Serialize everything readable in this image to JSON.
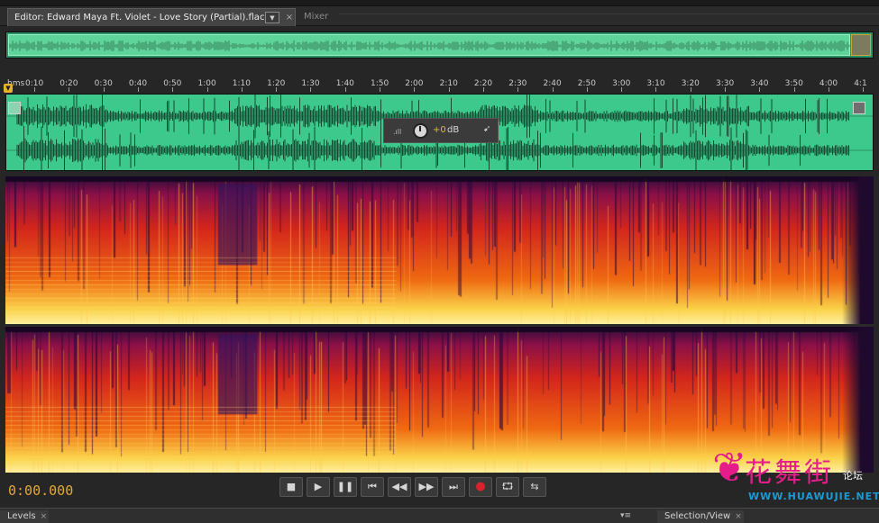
{
  "editor_tab": {
    "label": "Editor: Edward Maya Ft. Violet - Love Story  (Partial).flac",
    "dropdown": "▼",
    "close": "×"
  },
  "mixer_tab": {
    "label": "Mixer"
  },
  "ruler": {
    "unit": "hms",
    "ticks": [
      "0:10",
      "0:20",
      "0:30",
      "0:40",
      "0:50",
      "1:00",
      "1:10",
      "1:20",
      "1:30",
      "1:40",
      "1:50",
      "2:00",
      "2:10",
      "2:20",
      "2:30",
      "2:40",
      "2:50",
      "3:00",
      "3:10",
      "3:20",
      "3:30",
      "3:40",
      "3:50",
      "4:00",
      "4:1"
    ]
  },
  "hud": {
    "value": "+0",
    "unit": "dB"
  },
  "timecode": "0:00.000",
  "transport": {
    "stop": "■",
    "play": "▶",
    "pause": "❚❚",
    "to_start": "⏮",
    "rewind": "◀◀",
    "fast_forward": "▶▶",
    "to_end": "⏭",
    "record": "●",
    "loop": "⮔",
    "skip": "⇆"
  },
  "watermark": {
    "title": "花舞街",
    "sub": "论坛",
    "url": "WWW.HUAWUJIE.NET"
  },
  "panels": {
    "levels": "Levels",
    "selection_view": "Selection/View",
    "close": "×",
    "menu": "▾≡"
  },
  "colors": {
    "accent": "#e2a838",
    "waveform_bg": "#3dc98b",
    "record": "#d8232a",
    "watermark": "#e51c8a"
  }
}
